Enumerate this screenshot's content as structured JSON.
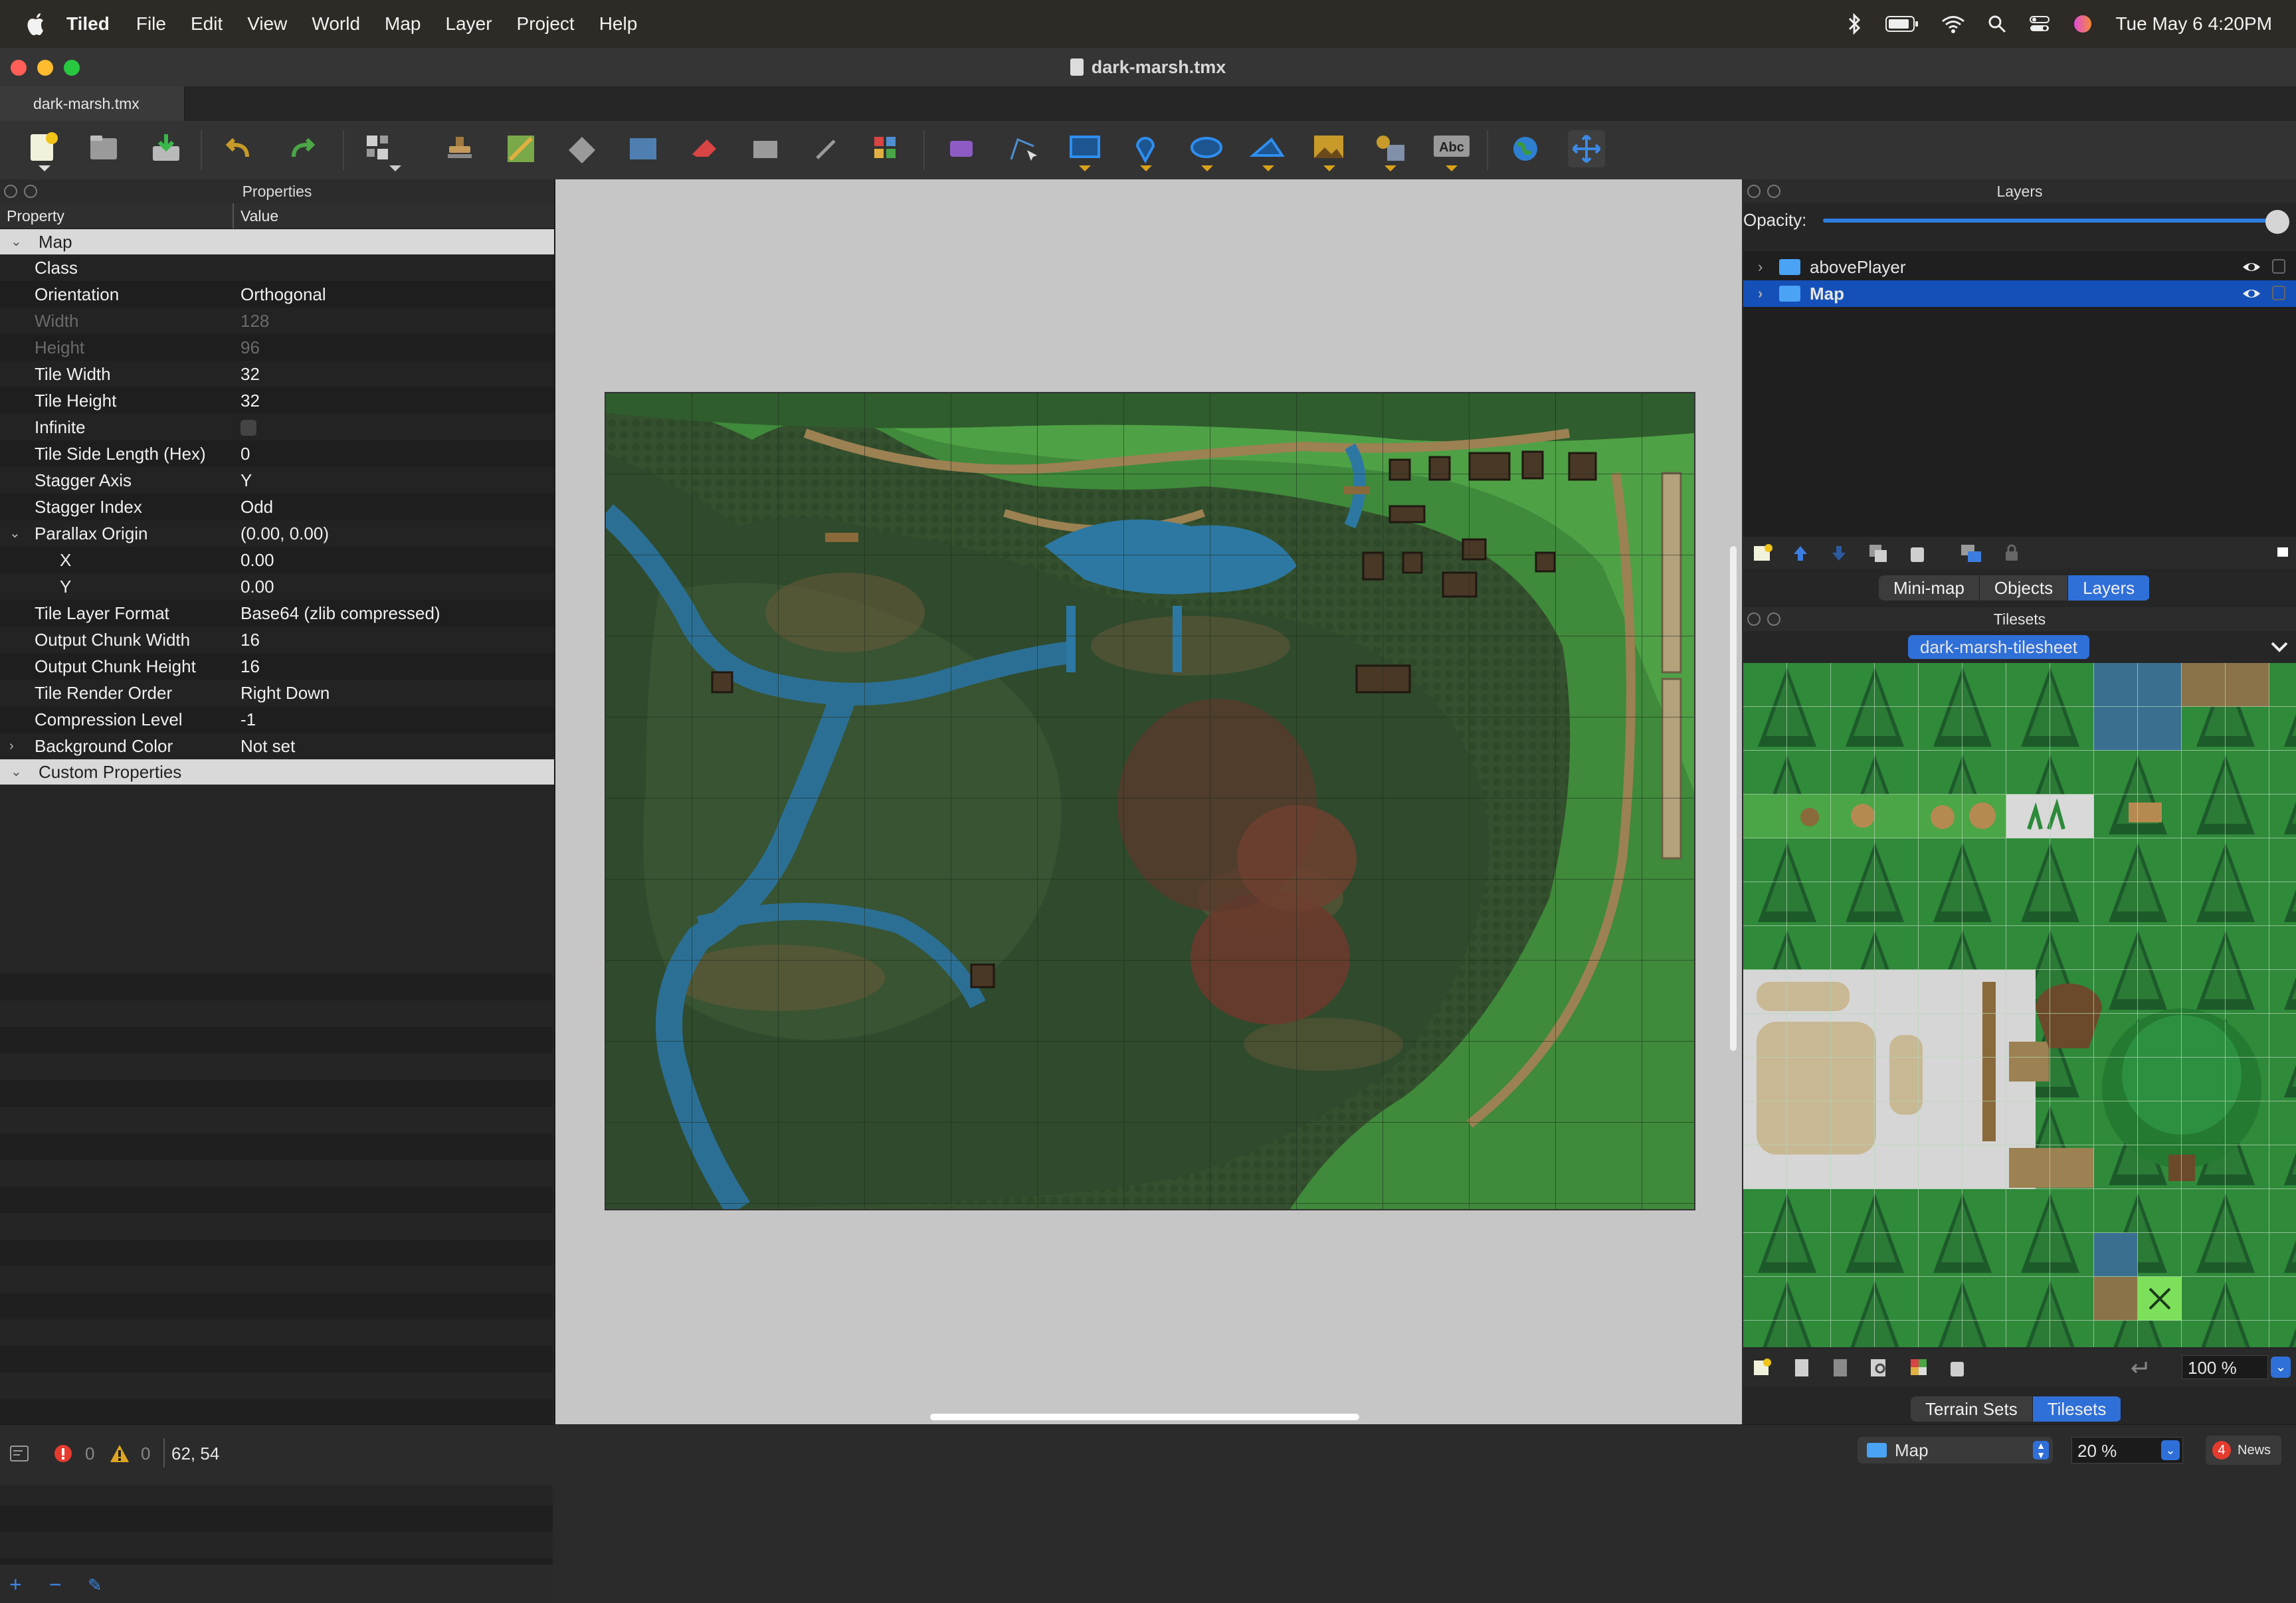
{
  "menubar": {
    "app": "Tiled",
    "items": [
      "File",
      "Edit",
      "View",
      "World",
      "Map",
      "Layer",
      "Project",
      "Help"
    ],
    "clock": "Tue May 6  4:20PM"
  },
  "window": {
    "title": "dark-marsh.tmx",
    "tab": "dark-marsh.tmx"
  },
  "properties_panel": {
    "title": "Properties",
    "col_property": "Property",
    "col_value": "Value",
    "group_map": "Map",
    "group_custom": "Custom Properties",
    "rows": [
      {
        "k": "Class",
        "v": ""
      },
      {
        "k": "Orientation",
        "v": "Orthogonal"
      },
      {
        "k": "Width",
        "v": "128"
      },
      {
        "k": "Height",
        "v": "96"
      },
      {
        "k": "Tile Width",
        "v": "32"
      },
      {
        "k": "Tile Height",
        "v": "32"
      },
      {
        "k": "Infinite",
        "v": ""
      },
      {
        "k": "Tile Side Length (Hex)",
        "v": "0"
      },
      {
        "k": "Stagger Axis",
        "v": "Y"
      },
      {
        "k": "Stagger Index",
        "v": "Odd"
      },
      {
        "k": "Parallax Origin",
        "v": "(0.00, 0.00)"
      },
      {
        "k": "X",
        "v": "0.00"
      },
      {
        "k": "Y",
        "v": "0.00"
      },
      {
        "k": "Tile Layer Format",
        "v": "Base64 (zlib compressed)"
      },
      {
        "k": "Output Chunk Width",
        "v": "16"
      },
      {
        "k": "Output Chunk Height",
        "v": "16"
      },
      {
        "k": "Tile Render Order",
        "v": "Right Down"
      },
      {
        "k": "Compression Level",
        "v": "-1"
      },
      {
        "k": "Background Color",
        "v": "Not set"
      }
    ]
  },
  "layers_panel": {
    "title": "Layers",
    "opacity_label": "Opacity:",
    "opacity": 1.0,
    "layers": [
      {
        "name": "abovePlayer",
        "selected": false
      },
      {
        "name": "Map",
        "selected": true
      }
    ],
    "tabs": [
      "Mini-map",
      "Objects",
      "Layers"
    ],
    "active_tab": "Layers"
  },
  "tilesets_panel": {
    "title": "Tilesets",
    "current": "dark-marsh-tilesheet",
    "zoom": "100 %",
    "tabs": [
      "Terrain Sets",
      "Tilesets"
    ],
    "active_tab": "Tilesets"
  },
  "statusbar": {
    "errors": "0",
    "warnings": "0",
    "coords": "62, 54",
    "layer": "Map",
    "zoom": "20 %",
    "news_count": "4",
    "news_label": "News"
  },
  "colors": {
    "accent": "#2f6fd8",
    "selection": "#1450b8",
    "map_grass": "#3d7a38",
    "map_water": "#2c6f95"
  }
}
